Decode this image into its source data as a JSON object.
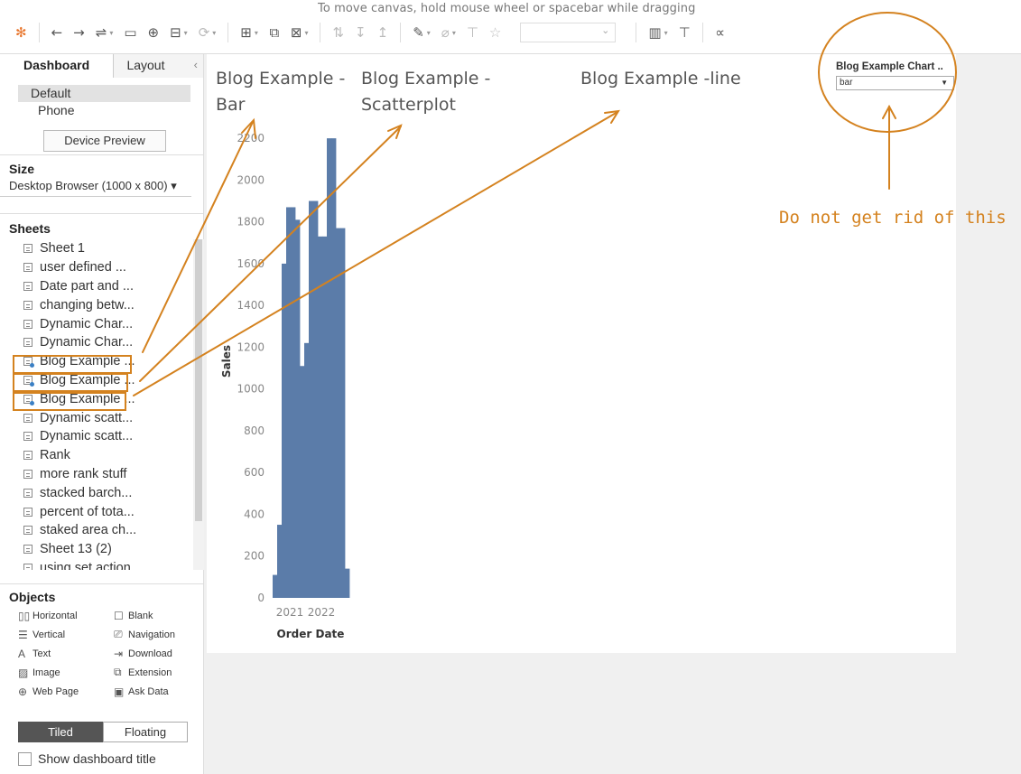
{
  "toolbar": {
    "hint": "To move canvas, hold mouse wheel or spacebar while dragging"
  },
  "left_panel": {
    "tabs": {
      "dashboard": "Dashboard",
      "layout": "Layout"
    },
    "device": {
      "default": "Default",
      "phone": "Phone",
      "preview_button": "Device Preview"
    },
    "size": {
      "title": "Size",
      "value": "Desktop Browser (1000 x 800) ▾"
    },
    "sheets_title": "Sheets",
    "sheets": [
      "Sheet 1",
      "user defined ...",
      "Date part and ...",
      "changing betw...",
      "Dynamic Char...",
      "Dynamic Char...",
      "Blog Example ...",
      "Blog Example ...",
      "Blog Example ...",
      "Dynamic scatt...",
      "Dynamic scatt...",
      "Rank",
      "more rank stuff",
      "stacked barch...",
      "percent of tota...",
      "staked area ch...",
      "Sheet 13 (2)",
      "using set action"
    ],
    "objects_title": "Objects",
    "objects": [
      {
        "label": "Horizontal",
        "icon": "horizontal-icon"
      },
      {
        "label": "Blank",
        "icon": "blank-icon"
      },
      {
        "label": "Vertical",
        "icon": "vertical-icon"
      },
      {
        "label": "Navigation",
        "icon": "navigation-icon"
      },
      {
        "label": "Text",
        "icon": "text-icon"
      },
      {
        "label": "Download",
        "icon": "download-icon"
      },
      {
        "label": "Image",
        "icon": "image-icon"
      },
      {
        "label": "Extension",
        "icon": "extension-icon"
      },
      {
        "label": "Web Page",
        "icon": "globe-icon"
      },
      {
        "label": "Ask Data",
        "icon": "ask-data-icon"
      }
    ],
    "mode": {
      "tiled": "Tiled",
      "floating": "Floating"
    },
    "show_title": "Show dashboard title"
  },
  "canvas": {
    "titles": {
      "bar": [
        "Blog Example -",
        "Bar"
      ],
      "scatter": [
        "Blog Example -",
        "Scatterplot"
      ],
      "line": "Blog Example -line"
    },
    "parameter": {
      "title": "Blog Example Chart ..",
      "value": "bar"
    }
  },
  "annotation": {
    "text": "Do not get rid of this",
    "color": "#d4821f"
  },
  "colors": {
    "bar": "#5b7ca9",
    "accent": "#d4821f"
  },
  "chart_data": {
    "type": "bar",
    "xlabel": "Order Date",
    "ylabel": "Sales",
    "x_tick_labels": [
      "2021",
      "2022"
    ],
    "y_ticks": [
      0,
      200,
      400,
      600,
      800,
      1000,
      1200,
      1400,
      1600,
      1800,
      2000,
      2200
    ],
    "ylim": [
      0,
      2300
    ],
    "values": [
      110,
      350,
      1600,
      1870,
      1870,
      1810,
      1110,
      1220,
      1900,
      1900,
      1730,
      1730,
      2200,
      2200,
      1770,
      1770,
      140
    ],
    "grid": false
  }
}
